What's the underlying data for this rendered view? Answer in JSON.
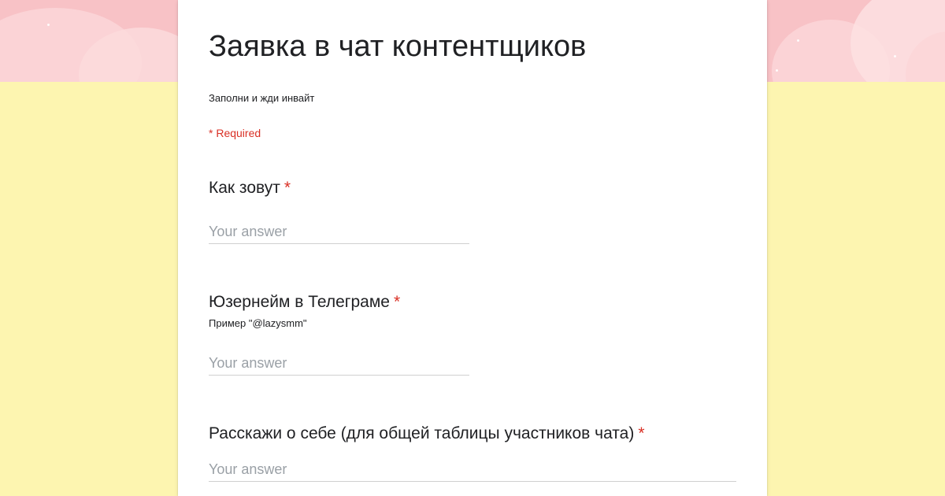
{
  "colors": {
    "page_background": "#fdf5b0",
    "header_band": "#f8c2c6",
    "card": "#ffffff",
    "required_red": "#d93025"
  },
  "form": {
    "title": "Заявка в чат контентщиков",
    "description": "Заполни и жди инвайт",
    "required_note": "* Required"
  },
  "questions": [
    {
      "label": "Как зовут",
      "required_mark": "*",
      "placeholder": "Your answer"
    },
    {
      "label": "Юзернейм в Телеграме",
      "required_mark": "*",
      "hint": "Пример \"@lazysmm\"",
      "placeholder": "Your answer"
    },
    {
      "label": "Расскажи о себе (для общей таблицы участников чата)",
      "required_mark": "*",
      "placeholder": "Your answer"
    }
  ]
}
